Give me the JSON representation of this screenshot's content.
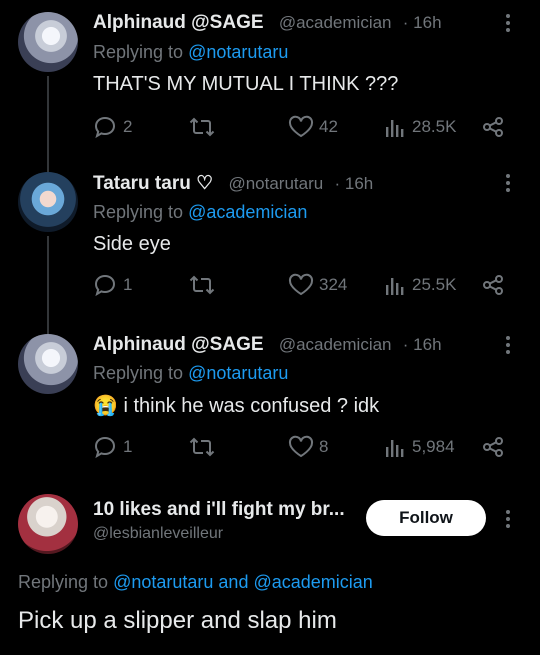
{
  "tweets": [
    {
      "name": "Alphinaud @SAGE",
      "handle": "@academician",
      "time": "· 16h",
      "replying_prefix": "Replying to",
      "replying_to": "@notarutaru",
      "text": "THAT'S MY MUTUAL I THINK ???",
      "replies": "2",
      "retweets": "",
      "likes": "42",
      "views": "28.5K"
    },
    {
      "name": "Tataru taru ♡",
      "handle": "@notarutaru",
      "time": "· 16h",
      "replying_prefix": "Replying to",
      "replying_to": "@academician",
      "text": "Side eye",
      "replies": "1",
      "retweets": "",
      "likes": "324",
      "views": "25.5K"
    },
    {
      "name": "Alphinaud @SAGE",
      "handle": "@academician",
      "time": "· 16h",
      "replying_prefix": "Replying to",
      "replying_to": "@notarutaru",
      "emoji": "😭",
      "text": "i think he was confused ? idk",
      "replies": "1",
      "retweets": "",
      "likes": "8",
      "views": "5,984"
    }
  ],
  "main": {
    "name": "10 likes and i'll fight my br...",
    "handle": "@lesbianleveilleur",
    "follow_label": "Follow",
    "replying_prefix": "Replying to",
    "replying_to_1": "@notarutaru",
    "replying_and": "and",
    "replying_to_2": "@academician",
    "text": "Pick up a slipper and slap him"
  },
  "colors": {
    "background": "#000000",
    "text": "#e7e9ea",
    "muted": "#71767b",
    "link": "#1d9bf0"
  }
}
